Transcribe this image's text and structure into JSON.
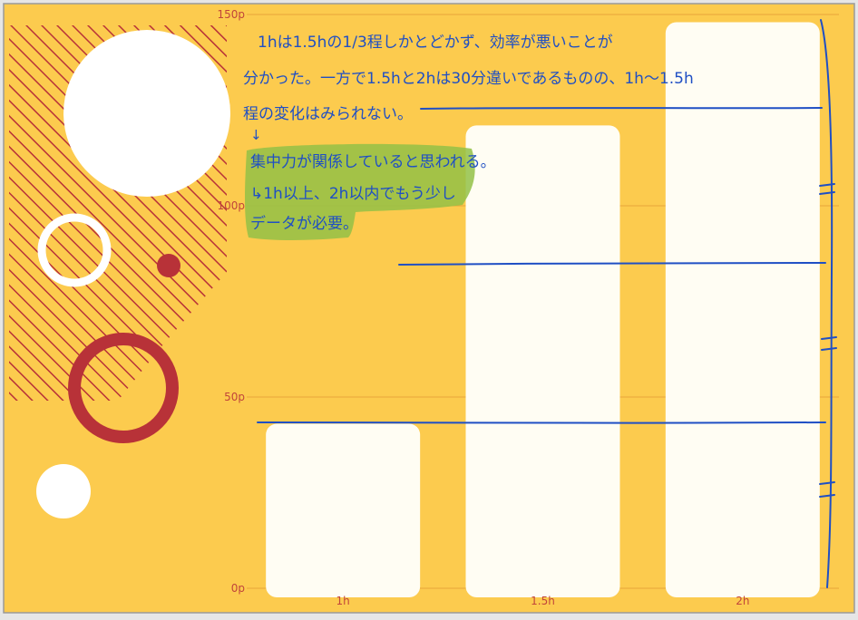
{
  "colors": {
    "background": "#fccb4e",
    "bar_fill": "#fffdf3",
    "grid_line": "#e9a53a",
    "tick_label": "#c1453a",
    "decor_red": "#b83238",
    "decor_white": "#ffffff",
    "ink": "#1f4fc4",
    "highlight": "#93c147",
    "frame": "#9a9a9a"
  },
  "chart_data": {
    "type": "bar",
    "categories": [
      "1h",
      "1.5h",
      "2h"
    ],
    "values": [
      43,
      121,
      148
    ],
    "ylim": [
      0,
      150
    ],
    "yticks": [
      0,
      50,
      100,
      150
    ],
    "ytick_labels": [
      "0p",
      "50p",
      "100p",
      "150p"
    ],
    "grid": true,
    "legend": "none"
  },
  "annotation": {
    "lines": [
      "1hは1.5hの1/3程しかとどかず、効率が悪いことが",
      "分かった。一方で1.5hと2hは30分違いであるものの、1h～1.5h",
      "程の変化はみられない。",
      "↓",
      "集中力が関係していると思われる。",
      "↳1h以上、2h以内でもう少し",
      "データが必要。"
    ]
  }
}
